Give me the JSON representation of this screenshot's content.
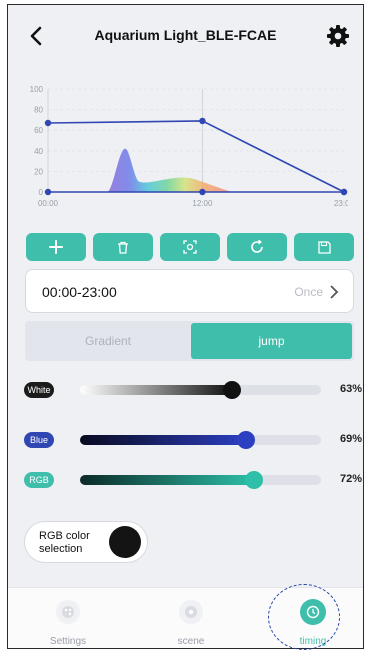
{
  "header": {
    "title": "Aquarium Light_BLE-FCAE"
  },
  "chart_data": {
    "type": "line",
    "y_ticks": [
      "100",
      "80",
      "60",
      "40",
      "20",
      "0"
    ],
    "x_ticks": [
      "00:00",
      "12:00",
      "23:00"
    ],
    "ylim": [
      0,
      100
    ],
    "series": [
      {
        "x": [
          "00:00",
          "12:00",
          "23:00"
        ],
        "values": [
          67,
          69,
          0
        ],
        "color": "#3047b3"
      }
    ],
    "baseline_points": [
      "00:00",
      "12:00",
      "23:00"
    ],
    "grid": true
  },
  "toolbar": [
    {
      "name": "add-icon"
    },
    {
      "name": "delete-icon"
    },
    {
      "name": "scan-icon"
    },
    {
      "name": "reset-icon"
    },
    {
      "name": "save-icon"
    }
  ],
  "time_range": {
    "value": "00:00-23:00",
    "mode": "Once"
  },
  "segment": {
    "gradient": "Gradient",
    "jump": "jump",
    "selected": "jump"
  },
  "channels": [
    {
      "label": "White",
      "percent_text": "63%",
      "value": 63,
      "chip_color": "#1b1b1b",
      "fill_start": "#ffffff",
      "fill_end": "#111111",
      "knob": "#111111"
    },
    {
      "label": "Blue",
      "percent_text": "69%",
      "value": 69,
      "chip_color": "#3047b3",
      "fill_start": "#0a0a20",
      "fill_end": "#2c3fc0",
      "knob": "#2c3fc0"
    },
    {
      "label": "RGB",
      "percent_text": "72%",
      "value": 72,
      "chip_color": "#3fbfab",
      "fill_start": "#0c2a26",
      "fill_end": "#2dbfa8",
      "knob": "#2dbfa8"
    }
  ],
  "rgb_selection": {
    "label": "RGB color selection",
    "color": "#141414"
  },
  "nav": [
    {
      "label": "Settings",
      "icon": "palette-icon",
      "active": false
    },
    {
      "label": "scene",
      "icon": "scene-icon",
      "active": false
    },
    {
      "label": "timing",
      "icon": "clock-icon",
      "active": true
    }
  ],
  "accent": "#3fbfab"
}
